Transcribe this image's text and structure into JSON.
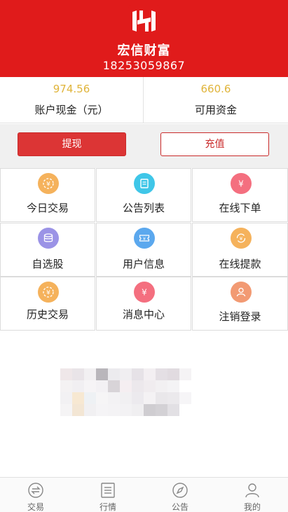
{
  "header": {
    "brand_name": "宏信财富",
    "phone": "18253059867",
    "brand_color": "#e01b1b"
  },
  "account": {
    "cash_value": "974.56",
    "cash_label": "账户现金（元）",
    "available_value": "660.6",
    "available_label": "可用资金"
  },
  "actions": {
    "withdraw_label": "提现",
    "recharge_label": "充值"
  },
  "menu": [
    {
      "label": "今日交易",
      "icon": "coin-icon",
      "color": "#f5b25c"
    },
    {
      "label": "公告列表",
      "icon": "document-icon",
      "color": "#3fc6e8"
    },
    {
      "label": "在线下单",
      "icon": "yen-icon",
      "color": "#f46f7f"
    },
    {
      "label": "自选股",
      "icon": "database-icon",
      "color": "#9b93e6"
    },
    {
      "label": "用户信息",
      "icon": "ticket-icon",
      "color": "#5ba8ee"
    },
    {
      "label": "在线提款",
      "icon": "refresh-coin-icon",
      "color": "#f5b25c"
    },
    {
      "label": "历史交易",
      "icon": "coin-icon",
      "color": "#f5b25c"
    },
    {
      "label": "消息中心",
      "icon": "yen-icon",
      "color": "#f46f7f"
    },
    {
      "label": "注销登录",
      "icon": "user-icon",
      "color": "#f29a73"
    }
  ],
  "tabbar": [
    {
      "label": "交易",
      "icon": "exchange-icon"
    },
    {
      "label": "行情",
      "icon": "list-icon"
    },
    {
      "label": "公告",
      "icon": "compass-icon"
    },
    {
      "label": "我的",
      "icon": "user-icon"
    }
  ]
}
